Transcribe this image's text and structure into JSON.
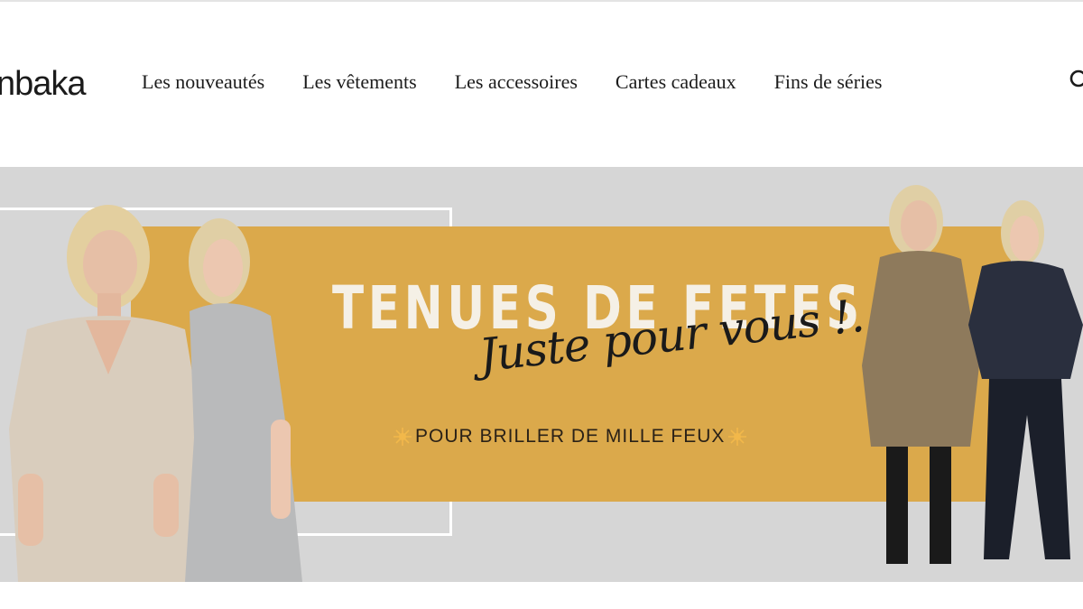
{
  "header": {
    "logo": "nbaka",
    "nav": [
      "Les nouveautés",
      "Les vêtements",
      "Les accessoires",
      "Cartes cadeaux",
      "Fins de séries"
    ],
    "search_icon": "search-icon"
  },
  "hero": {
    "title": "TENUES DE FETES",
    "script": "Juste pour vous !.",
    "tagline": "POUR BRILLER DE MILLE FEUX",
    "colors": {
      "background": "#d6d6d6",
      "accent": "#dba94b",
      "frame": "#ffffff"
    }
  }
}
